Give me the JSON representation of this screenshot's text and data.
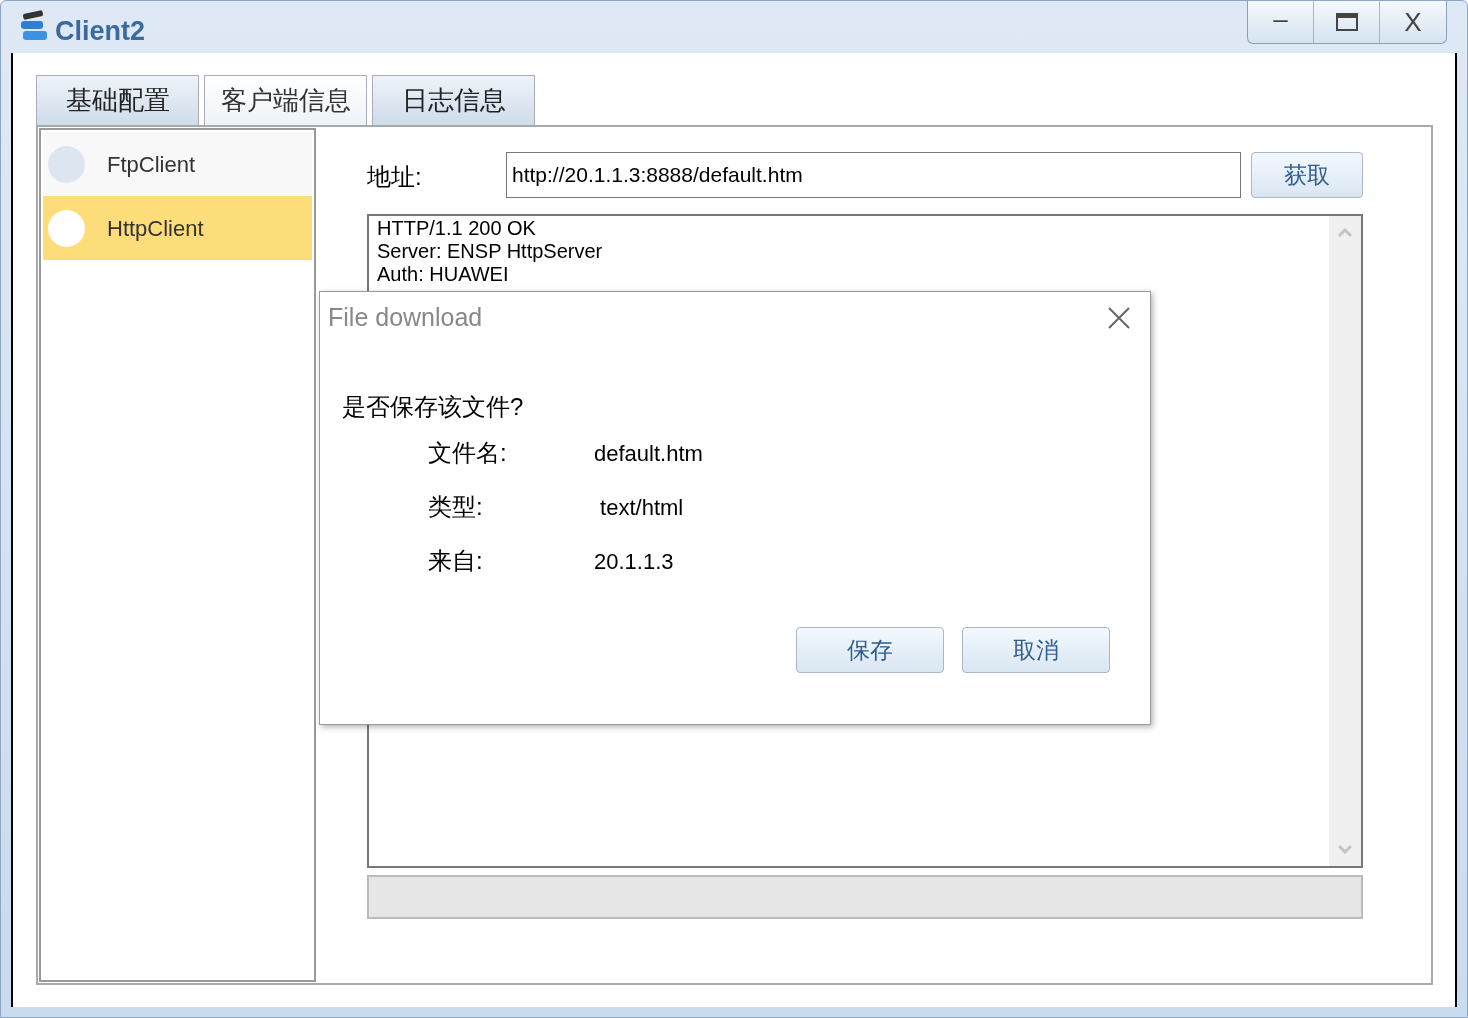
{
  "window": {
    "title": "Client2",
    "controls": [
      "–",
      "X"
    ]
  },
  "tabs": [
    {
      "label": "基础配置",
      "selected": false
    },
    {
      "label": "客户端信息",
      "selected": true
    },
    {
      "label": "日志信息",
      "selected": false
    }
  ],
  "sidebar": {
    "items": [
      {
        "label": "FtpClient",
        "selected": false
      },
      {
        "label": "HttpClient",
        "selected": true
      }
    ]
  },
  "address": {
    "label": "地址:",
    "value": "http://20.1.1.3:8888/default.htm",
    "button": "获取"
  },
  "response": {
    "lines": [
      "HTTP/1.1 200 OK",
      "Server: ENSP HttpServer",
      "Auth: HUAWEI"
    ]
  },
  "progress": {
    "level": 0
  },
  "dialog": {
    "title": "File download",
    "question": "是否保存该文件?",
    "fields": [
      {
        "label": "文件名:",
        "value": "default.htm"
      },
      {
        "label": "类型:",
        "value": " text/html"
      },
      {
        "label": "来自:",
        "value": "20.1.1.3"
      }
    ],
    "buttons": [
      "保存",
      "取消"
    ]
  }
}
